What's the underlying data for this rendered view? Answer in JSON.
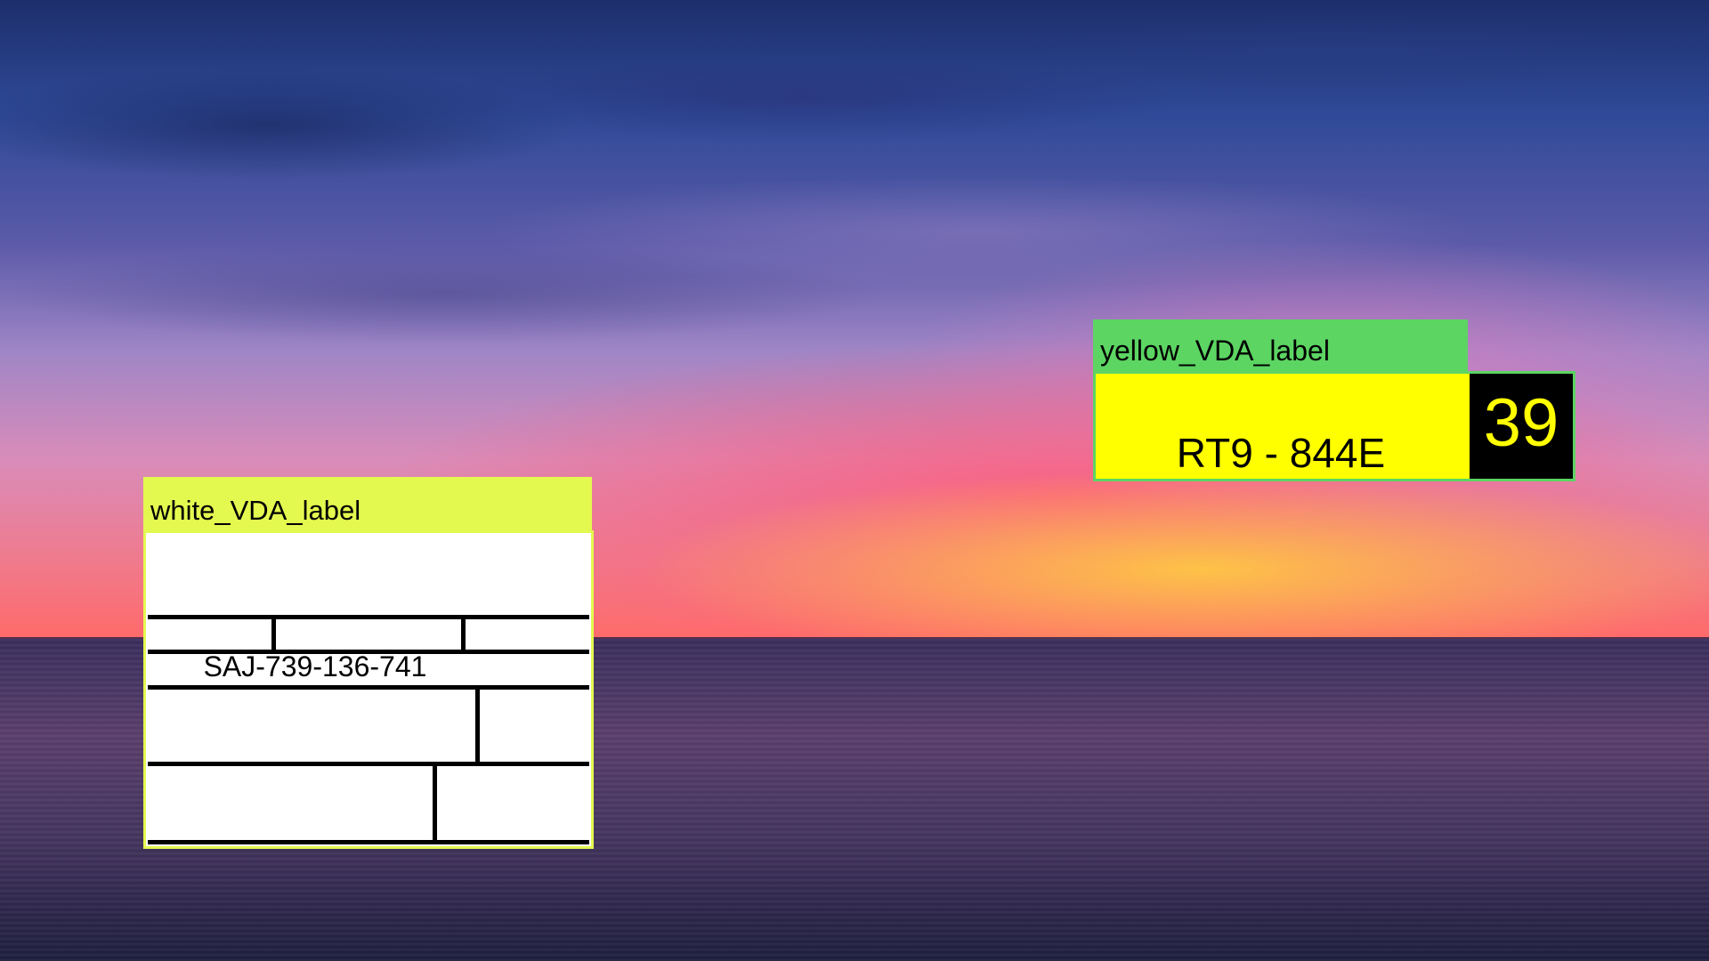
{
  "background": {
    "scene": "sunset-over-sea",
    "colors": {
      "sky_top": "#1d2e6b",
      "sky_glow": "#ff6a6a",
      "sea": "#3b2f5e"
    }
  },
  "labels": {
    "white": {
      "tag": "white_VDA_label",
      "tag_color": "#e4f94f",
      "code": "SAJ-739-136-741"
    },
    "yellow": {
      "tag": "yellow_VDA_label",
      "tag_color": "#5cd562",
      "code": "RT9 - 844E",
      "number": "39"
    }
  }
}
